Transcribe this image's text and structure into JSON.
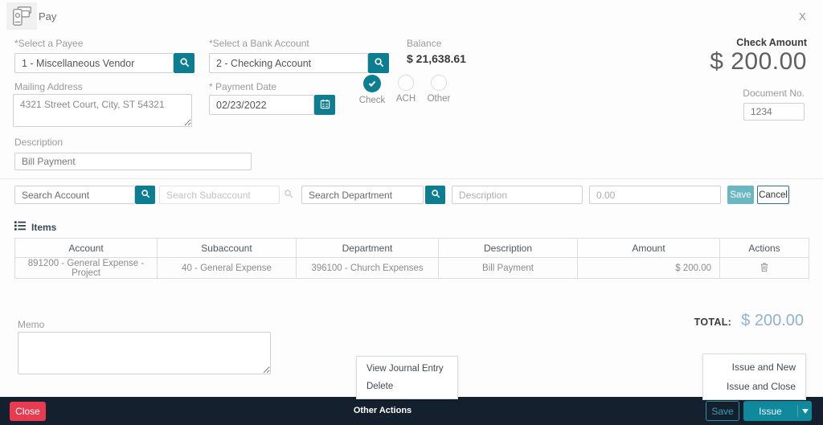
{
  "header": {
    "title": "Pay",
    "close_label": "X"
  },
  "payee": {
    "label": "*Select a Payee",
    "value": "1 - Miscellaneous Vendor"
  },
  "bank_account": {
    "label": "*Select a Bank Account",
    "value": "2 - Checking Account"
  },
  "balance": {
    "label": "Balance",
    "value": "$ 21,638.61"
  },
  "check_amount": {
    "label": "Check Amount",
    "value": "$ 200.00"
  },
  "mailing_address": {
    "label": "Mailing Address",
    "value": "4321 Street Court, City, ST 54321"
  },
  "payment_date": {
    "label": "* Payment Date",
    "value": "02/23/2022"
  },
  "payment_methods": {
    "options": [
      {
        "label": "Check",
        "selected": true
      },
      {
        "label": "ACH",
        "selected": false
      },
      {
        "label": "Other",
        "selected": false
      }
    ]
  },
  "document_no": {
    "label": "Document No.",
    "value": "1234"
  },
  "description": {
    "label": "Description",
    "value": "Bill Payment"
  },
  "item_entry": {
    "account_placeholder": "Search Account",
    "subaccount_placeholder": "Search Subaccount",
    "department_placeholder": "Search Department",
    "description_placeholder": "Description",
    "amount_placeholder": "0.00",
    "save_label": "Save",
    "cancel_label": "Cancel"
  },
  "items": {
    "section_label": "Items",
    "columns": [
      "Account",
      "Subaccount",
      "Department",
      "Description",
      "Amount",
      "Actions"
    ],
    "rows": [
      {
        "account": "891200 - General Expense - Project",
        "subaccount": "40 - General Expense",
        "department": "396100 - Church Expenses",
        "description": "Bill Payment",
        "amount": "$ 200.00"
      }
    ]
  },
  "memo": {
    "label": "Memo",
    "value": ""
  },
  "total": {
    "label": "TOTAL:",
    "value": "$ 200.00"
  },
  "other_actions_menu": {
    "items": [
      "View Journal Entry",
      "Delete"
    ]
  },
  "issue_menu": {
    "items": [
      "Issue and New",
      "Issue and Close"
    ]
  },
  "footer": {
    "close_label": "Close",
    "other_actions_label": "Other Actions",
    "save_label": "Save",
    "issue_label": "Issue"
  },
  "icons": {
    "header": "pay-icon",
    "lookup": "search-icon",
    "date": "calendar-icon",
    "items_section": "list-icon",
    "row_action": "trash-icon",
    "issue_split": "caret-down-icon"
  },
  "colors": {
    "teal": "#0d7e91",
    "teal_bright": "#11899d",
    "teal_muted": "#6ab6c3",
    "footer_bg": "#14202e",
    "close_red": "#e73b51",
    "total_value_blue": "#8fb3cd"
  }
}
